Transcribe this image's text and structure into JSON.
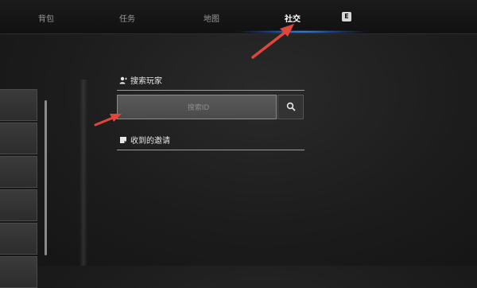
{
  "tabs": [
    {
      "label": "背包",
      "active": false
    },
    {
      "label": "任务",
      "active": false
    },
    {
      "label": "地图",
      "active": false
    },
    {
      "label": "社交",
      "active": true
    }
  ],
  "key_hint": "E",
  "search_section": {
    "title": "搜索玩家",
    "icon": "add-user-icon",
    "placeholder": "搜索ID",
    "button_icon": "search-icon"
  },
  "invites_section": {
    "title": "收到的邀请",
    "icon": "note-icon"
  },
  "colors": {
    "active_glow": "#5aaaff",
    "arrow": "#e0463a"
  }
}
